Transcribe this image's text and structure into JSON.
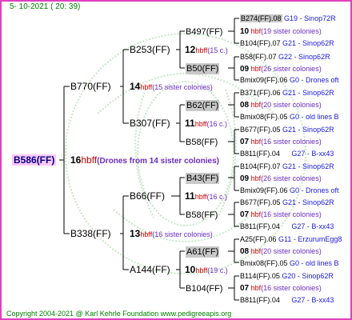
{
  "date_time": "5- 10-2021 ( 20: 39)",
  "copyright": "Copyright 2004-2021 @ Karl Kehrle Foundation    www.pedigreeapis.org",
  "root": {
    "name": "B586(FF)",
    "count": "16",
    "hbff": "hbff",
    "sisters": "(Drones from 14 sister colonies)"
  },
  "gen1": {
    "top": {
      "name": "B770(FF)",
      "count": "14",
      "hbff": "hbff",
      "sisters": "(15 sister colonies)"
    },
    "bottom": {
      "name": "B338(FF)",
      "count": "13",
      "hbff": "hbff",
      "sisters": "(16 sister colonies)"
    }
  },
  "gen2": {
    "a": {
      "name": "B253(FF)",
      "count": "12",
      "hbff": "hbff",
      "sisters": "(15 c.)"
    },
    "b": {
      "name": "B307(FF)",
      "count": "11",
      "hbff": "hbff",
      "sisters": "(16 c.)"
    },
    "c": {
      "name": "B66(FF)",
      "count": "11",
      "hbff": "hbff",
      "sisters": "(16 c.)"
    },
    "d": {
      "name": "A144(FF)",
      "count": "10",
      "hbff": "hbff",
      "sisters": "(19 c.)"
    }
  },
  "gen3": [
    {
      "name": "B497(FF)"
    },
    {
      "name": "B50(FF)"
    },
    {
      "name": "B62(FF)"
    },
    {
      "name": "B58(FF)"
    },
    {
      "name": "B43(FF)"
    },
    {
      "name": "B58(FF)"
    },
    {
      "name": "A61(FF)"
    },
    {
      "name": "B104(FF)"
    }
  ],
  "gen4": [
    {
      "line": "B274(FF).08",
      "loc": "G19 - Sinop72R"
    },
    {
      "num": "10",
      "hb": "hbf",
      "sis": "(19 sister colonies)"
    },
    {
      "line": "B104(FF).07",
      "loc": "G21 - Sinop62R"
    },
    {
      "line": "B58(FF).07",
      "loc": "G22 - Sinop62R"
    },
    {
      "num": "09",
      "hb": "hbf",
      "sis": "(26 sister colonies)"
    },
    {
      "line": "Bmix09(FF).06",
      "loc": "G0 - Drones oft"
    },
    {
      "line": "B371(FF).06",
      "loc": "G21 - Sinop62R"
    },
    {
      "num": "08",
      "hb": "hbf",
      "sis": "(20 sister colonies)"
    },
    {
      "line": "Bmix08(FF).05",
      "loc": "G0 - old lines B"
    },
    {
      "line": "B677(FF).05",
      "loc": "G21 - Sinop62R"
    },
    {
      "num": "07",
      "hb": "hbf",
      "sis": "(16 sister colonies)"
    },
    {
      "line": "B811(FF).04",
      "loc": "G27 - B-xx43"
    },
    {
      "line": "B104(FF).07",
      "loc": "G21 - Sinop62R"
    },
    {
      "num": "09",
      "hb": "hbf",
      "sis": "(26 sister colonies)"
    },
    {
      "line": "Bmix09(FF).06",
      "loc": "G0 - Drones oft"
    },
    {
      "line": "B677(FF).05",
      "loc": "G21 - Sinop62R"
    },
    {
      "num": "07",
      "hb": "hbf",
      "sis": "(16 sister colonies)"
    },
    {
      "line": "B811(FF).04",
      "loc": "G27 - B-xx43"
    },
    {
      "line": "A25(FF).06",
      "loc": "G11 - ErzurumEgg8"
    },
    {
      "num": "08",
      "hb": "hbf",
      "sis": "(20 sister colonies)"
    },
    {
      "line": "Bmix08(FF).05",
      "loc": "G0 - old lines B"
    },
    {
      "line": "B114(FF).05",
      "loc": "G20 - Sinop62R"
    },
    {
      "num": "07",
      "hb": "hbf",
      "sis": "(16 sister colonies)"
    },
    {
      "line": "B811(FF).04",
      "loc": "G27 - B-xx43"
    }
  ],
  "colors": {
    "border": "#e040c0",
    "root_highlight": "#ffc8ff",
    "box_highlight": "#c8c8c8",
    "hbf": "#cc0000",
    "sisters": "#6a2cc0",
    "location": "#1a1ae0",
    "footer": "#008000"
  }
}
